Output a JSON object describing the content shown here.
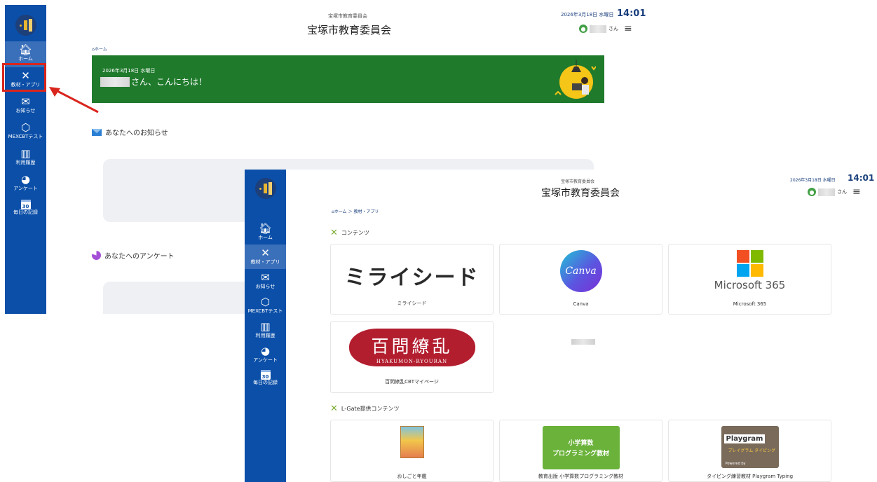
{
  "colors": {
    "sidebar": "#0b4fa8",
    "banner": "#1f7a2c",
    "highlight": "#d9251c",
    "accent_navy": "#1a3f7d"
  },
  "nav": [
    {
      "label": "ホーム",
      "icon": "home-icon"
    },
    {
      "label": "教材・アプリ",
      "icon": "tools-icon"
    },
    {
      "label": "お知らせ",
      "icon": "mail-icon"
    },
    {
      "label": "MEXCBTテスト",
      "icon": "cube-icon"
    },
    {
      "label": "利用履歴",
      "icon": "bar-chart-icon"
    },
    {
      "label": "アンケート",
      "icon": "pie-icon"
    },
    {
      "label": "毎日の記録",
      "icon": "calendar-icon"
    }
  ],
  "calendar_day": "30",
  "screen_home": {
    "org_small": "宝塚市教育委員会",
    "org_title": "宝塚市教育委員会",
    "date": "2026年3月18日 水曜日",
    "time": "14:01",
    "user_suffix": "さん",
    "breadcrumb": "ホーム",
    "banner_date": "2026年3月18日 水曜日",
    "banner_greeting": "さん、こんにちは！",
    "section_notice": "あなたへのお知らせ",
    "section_survey": "あなたへのアンケート"
  },
  "screen_apps": {
    "org_small": "宝塚市教育委員会",
    "org_title": "宝塚市教育委員会",
    "date": "2026年3月18日 水曜日",
    "time": "14:01",
    "user_suffix": "さん",
    "breadcrumb": "ホーム ＞ 教材・アプリ",
    "section_contents": "コンテンツ",
    "section_lgate": "L-Gate提供コンテンツ",
    "apps": [
      {
        "label": "ミライシード",
        "logo_text": "ミライシード"
      },
      {
        "label": "Canva",
        "logo_text": "Canva"
      },
      {
        "label": "Microsoft 365",
        "logo_text": "Microsoft 365"
      },
      {
        "label": "百問繚乱CBTマイページ",
        "logo_text": "百問繚乱",
        "logo_sub": "HYAKUMON-RYOURAN"
      }
    ],
    "lgate_apps": [
      {
        "label": "おしごと年鑑"
      },
      {
        "label": "教育出版 小学算数プログラミング教材",
        "thumb_line1": "小学算数",
        "thumb_line2": "プログラミング教材"
      },
      {
        "label": "タイピング練習教材 Playgram Typing",
        "thumb_title": "Playgram",
        "thumb_sub": "プレイグラム タイピング",
        "thumb_foot": "Powered by"
      }
    ]
  }
}
